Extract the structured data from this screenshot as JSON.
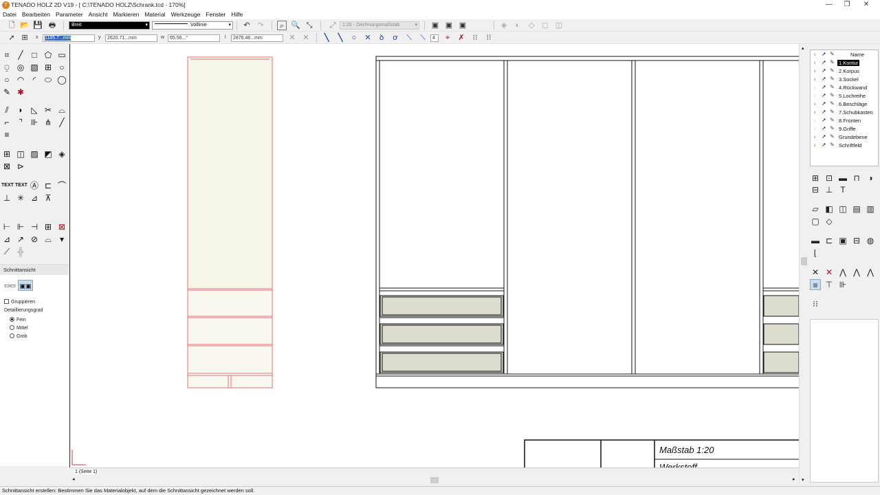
{
  "window": {
    "title": "TENADO HOLZ 2D V19 - [ C:\\TENADO HOLZ\\Schrank.tcd - 170%]",
    "minimize": "—",
    "maximize": "❐",
    "close": "✕"
  },
  "menu": [
    "Datei",
    "Bearbeiten",
    "Parameter",
    "Ansicht",
    "Markieren",
    "Material",
    "Werkzeuge",
    "Fenster",
    "Hilfe"
  ],
  "toolbar1": {
    "pen_combo": "Breit",
    "line_style": "Volllinie",
    "scale_combo": "1:20 - Zeichnungsmaßstab"
  },
  "coords": {
    "x_label": "x",
    "x_value": "1185.7...mm",
    "y_label": "y",
    "y_value": "2620.71...mm",
    "w_label": "w",
    "w_value": "65.56...°",
    "l_label": "l",
    "l_value": "2876.46...mm",
    "step_value": "4"
  },
  "left_panel": {
    "text_tool_1": "TEXT",
    "text_tool_2": "TEXT",
    "section_title": "Schnittansicht",
    "group_label": "Gruppieren",
    "detail_label": "Detaillierungsgrad",
    "detail_options": [
      "Fein",
      "Mittel",
      "Grob"
    ],
    "detail_selected": "Fein"
  },
  "layers": {
    "header": "Name",
    "items": [
      "1.Kontur",
      "2.Korpus",
      "3.Sockel",
      "4.Rückwand",
      "5.Lochreihe",
      "6.Beschläge",
      "7.Schubkasten",
      "8.Fronten",
      "9.Griffe",
      "Grundebene",
      "Schriftfeld"
    ],
    "selected": "1.Kontur"
  },
  "drawing": {
    "scale_text": "Maßstab 1:20",
    "partial_text": "Werkstoff"
  },
  "page_tab": "1 (Seite 1)",
  "status": "Schnittansicht erstellen: Bestimmen Sie das Materialobjekt, auf dem die Schnittansicht gezeichnet werden soll.",
  "colors": {
    "contour_red": "#e8707a",
    "drawer_fill": "#dcdcd0",
    "paper_fill": "#f8f8ee",
    "layer_bulb": "#6b7d16"
  }
}
